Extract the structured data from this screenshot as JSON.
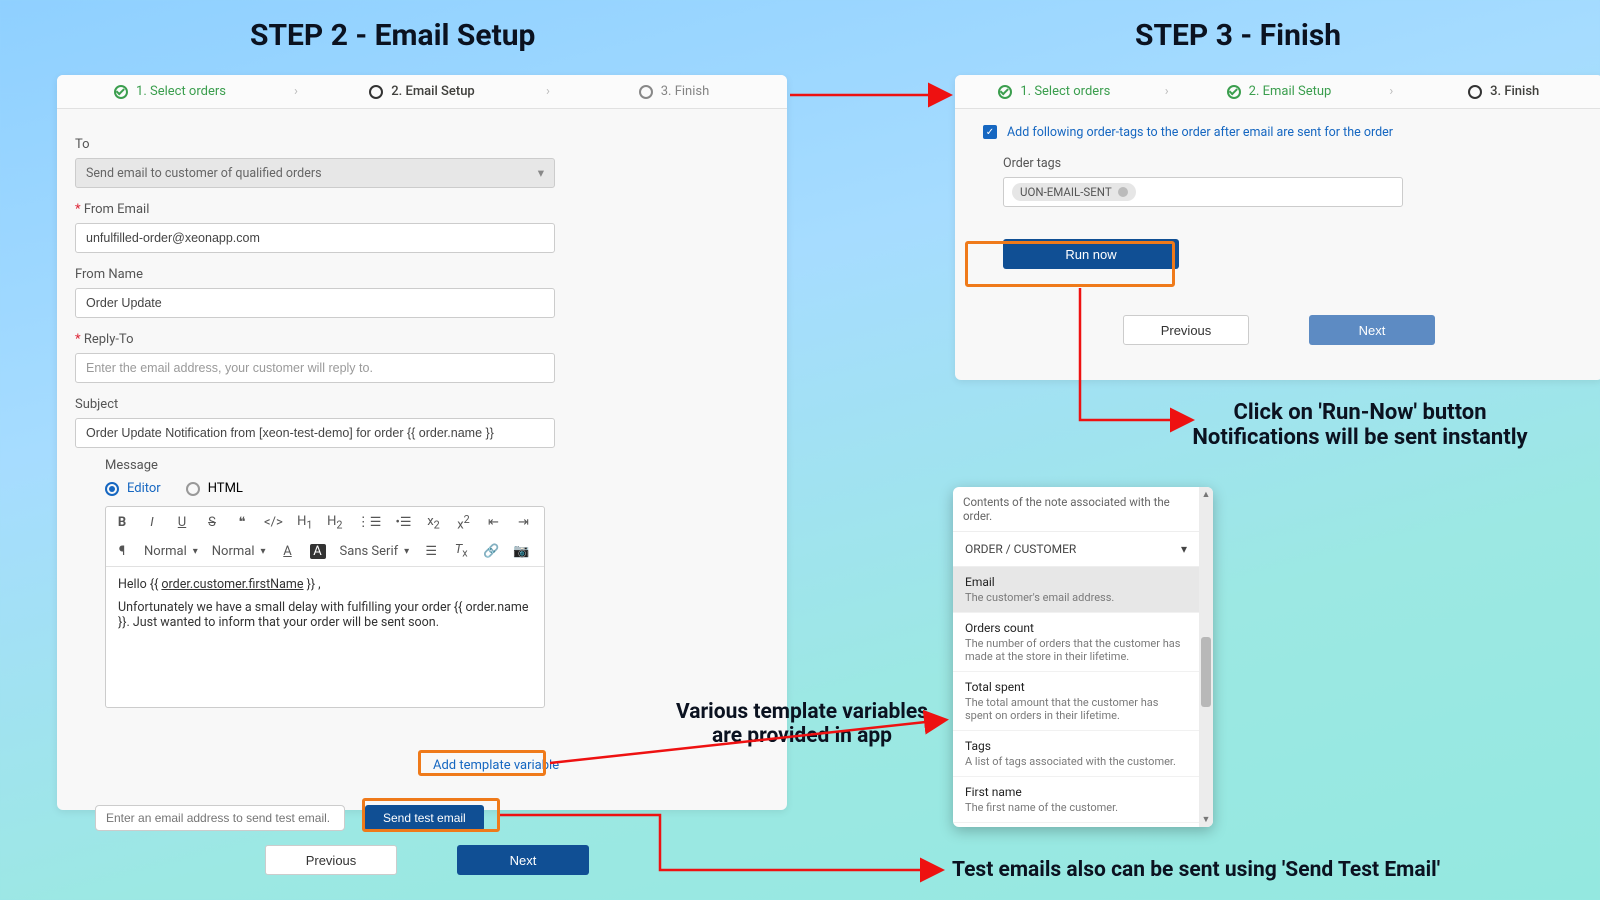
{
  "titles": {
    "step2": "STEP 2 - Email Setup",
    "step3": "STEP 3 - Finish"
  },
  "wizard_left": {
    "s1": "1. Select orders",
    "s2": "2. Email Setup",
    "s3": "3. Finish"
  },
  "wizard_right": {
    "s1": "1. Select orders",
    "s2": "2. Email Setup",
    "s3": "3. Finish"
  },
  "left_form": {
    "to_label": "To",
    "to_value": "Send email to customer of qualified orders",
    "from_email_label": "From Email",
    "from_email_value": "unfulfilled-order@xeonapp.com",
    "from_name_label": "From Name",
    "from_name_value": "Order Update",
    "reply_to_label": "Reply-To",
    "reply_to_placeholder": "Enter the email address, your customer will reply to.",
    "subject_label": "Subject",
    "subject_value": "Order Update Notification from [xeon-test-demo] for order {{ order.name }}",
    "message_label": "Message",
    "radio_editor": "Editor",
    "radio_html": "HTML",
    "toolbar": {
      "normal1": "Normal",
      "normal2": "Normal",
      "font": "Sans Serif"
    },
    "body_line1_a": "Hello {{ ",
    "body_line1_var": "order.customer.firstName",
    "body_line1_b": " }} ,",
    "body_line2": "Unfortunately we have a small delay with fulfilling your order {{ order.name }}. Just wanted to inform that your order will be sent soon.",
    "add_tpl_label": "Add template variable",
    "test_placeholder": "Enter an email address to send test email.",
    "send_test_label": "Send test email",
    "prev_label": "Previous",
    "next_label": "Next"
  },
  "right_form": {
    "chk_text": "Add following order-tags to the order after email are sent for the order",
    "tags_label": "Order tags",
    "tag_chip": "UON-EMAIL-SENT",
    "run_now": "Run now",
    "prev_label": "Previous",
    "next_label": "Next"
  },
  "annotations": {
    "tpl_vars_l1": "Various template variables",
    "tpl_vars_l2": "are provided in app",
    "runnow_l1": "Click on 'Run-Now' button",
    "runnow_l2": "Notifications will be sent instantly",
    "testmail": "Test emails also can be sent using 'Send Test Email'"
  },
  "popover": {
    "note": "Contents of the note associated with the order.",
    "section": "ORDER / CUSTOMER",
    "items": [
      {
        "t": "Email",
        "d": "The customer's email address."
      },
      {
        "t": "Orders count",
        "d": "The number of orders that the customer has made at the store in their lifetime."
      },
      {
        "t": "Total spent",
        "d": "The total amount that the customer has spent on orders in their lifetime."
      },
      {
        "t": "Tags",
        "d": "A list of tags associated with the customer."
      },
      {
        "t": "First name",
        "d": "The first name of the customer."
      }
    ]
  }
}
